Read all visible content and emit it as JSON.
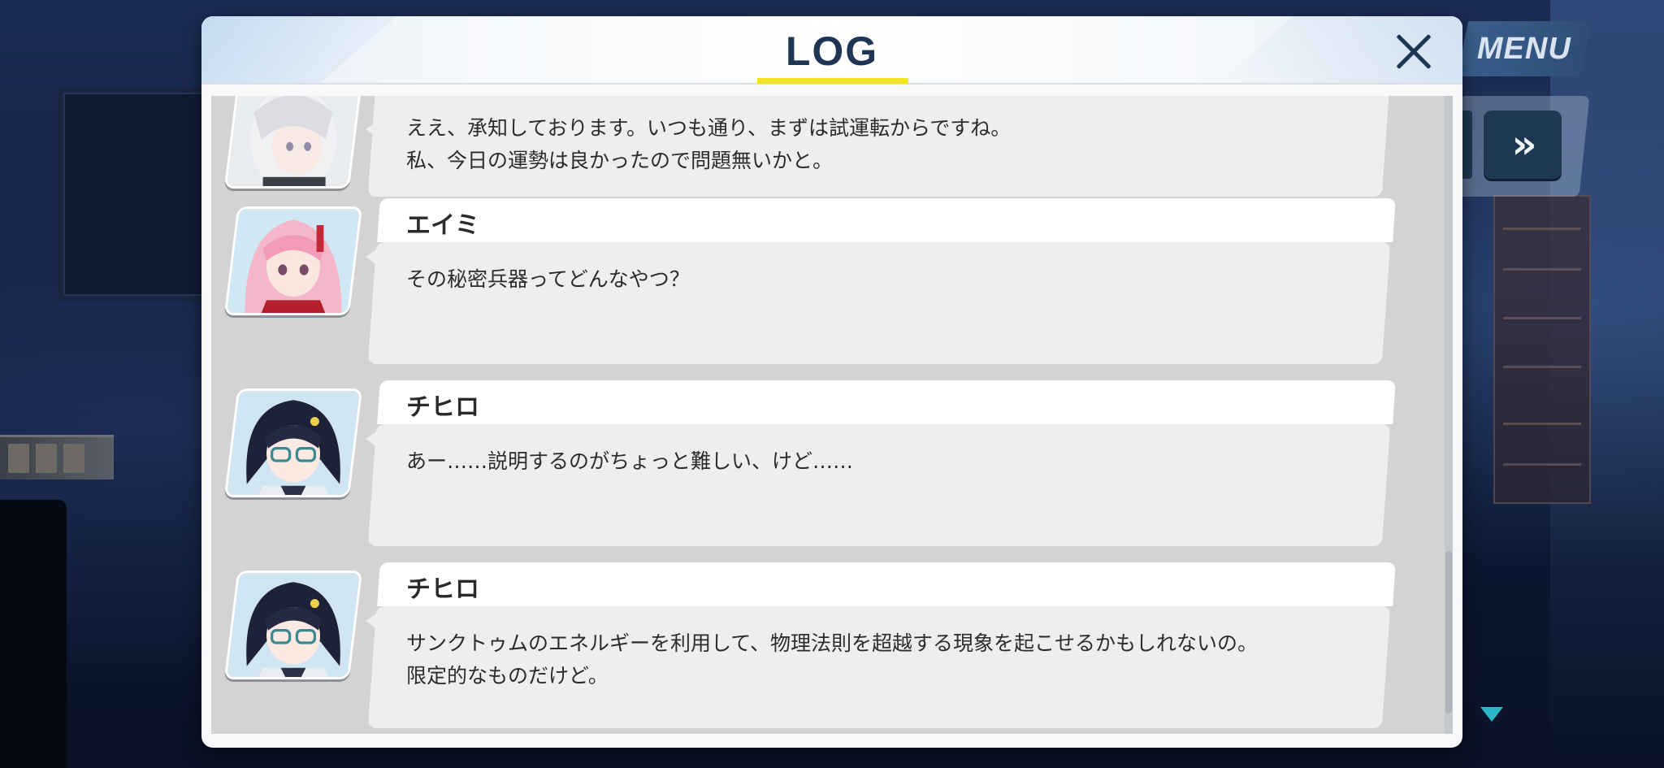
{
  "dialog": {
    "title": "LOG",
    "close_icon": "close-icon"
  },
  "hud": {
    "menu_label": "MENU",
    "fast_forward_label": "»",
    "scroll_down_icon": "triangle-down-icon"
  },
  "colors": {
    "title": "#1f3554",
    "title_underline": "#f3e325",
    "menu_button": "#2e4e78",
    "scroll_indicator": "#2ab7c9"
  },
  "log": {
    "entries": [
      {
        "speaker": "",
        "avatar": "white-haired-girl-avatar",
        "lines": [
          "ええ、承知しております。いつも通り、まずは試運転からですね。",
          "私、今日の運勢は良かったので問題無いかと。"
        ]
      },
      {
        "speaker": "エイミ",
        "avatar": "pink-haired-girl-avatar",
        "lines": [
          "その秘密兵器ってどんなやつ？"
        ]
      },
      {
        "speaker": "チヒロ",
        "avatar": "dark-haired-glasses-girl-avatar",
        "lines": [
          "あー……説明するのがちょっと難しい、けど……"
        ]
      },
      {
        "speaker": "チヒロ",
        "avatar": "dark-haired-glasses-girl-avatar",
        "lines": [
          "サンクトゥムのエネルギーを利用して、物理法則を超越する現象を起こせるかもしれないの。",
          "限定的なものだけど。"
        ]
      }
    ]
  }
}
